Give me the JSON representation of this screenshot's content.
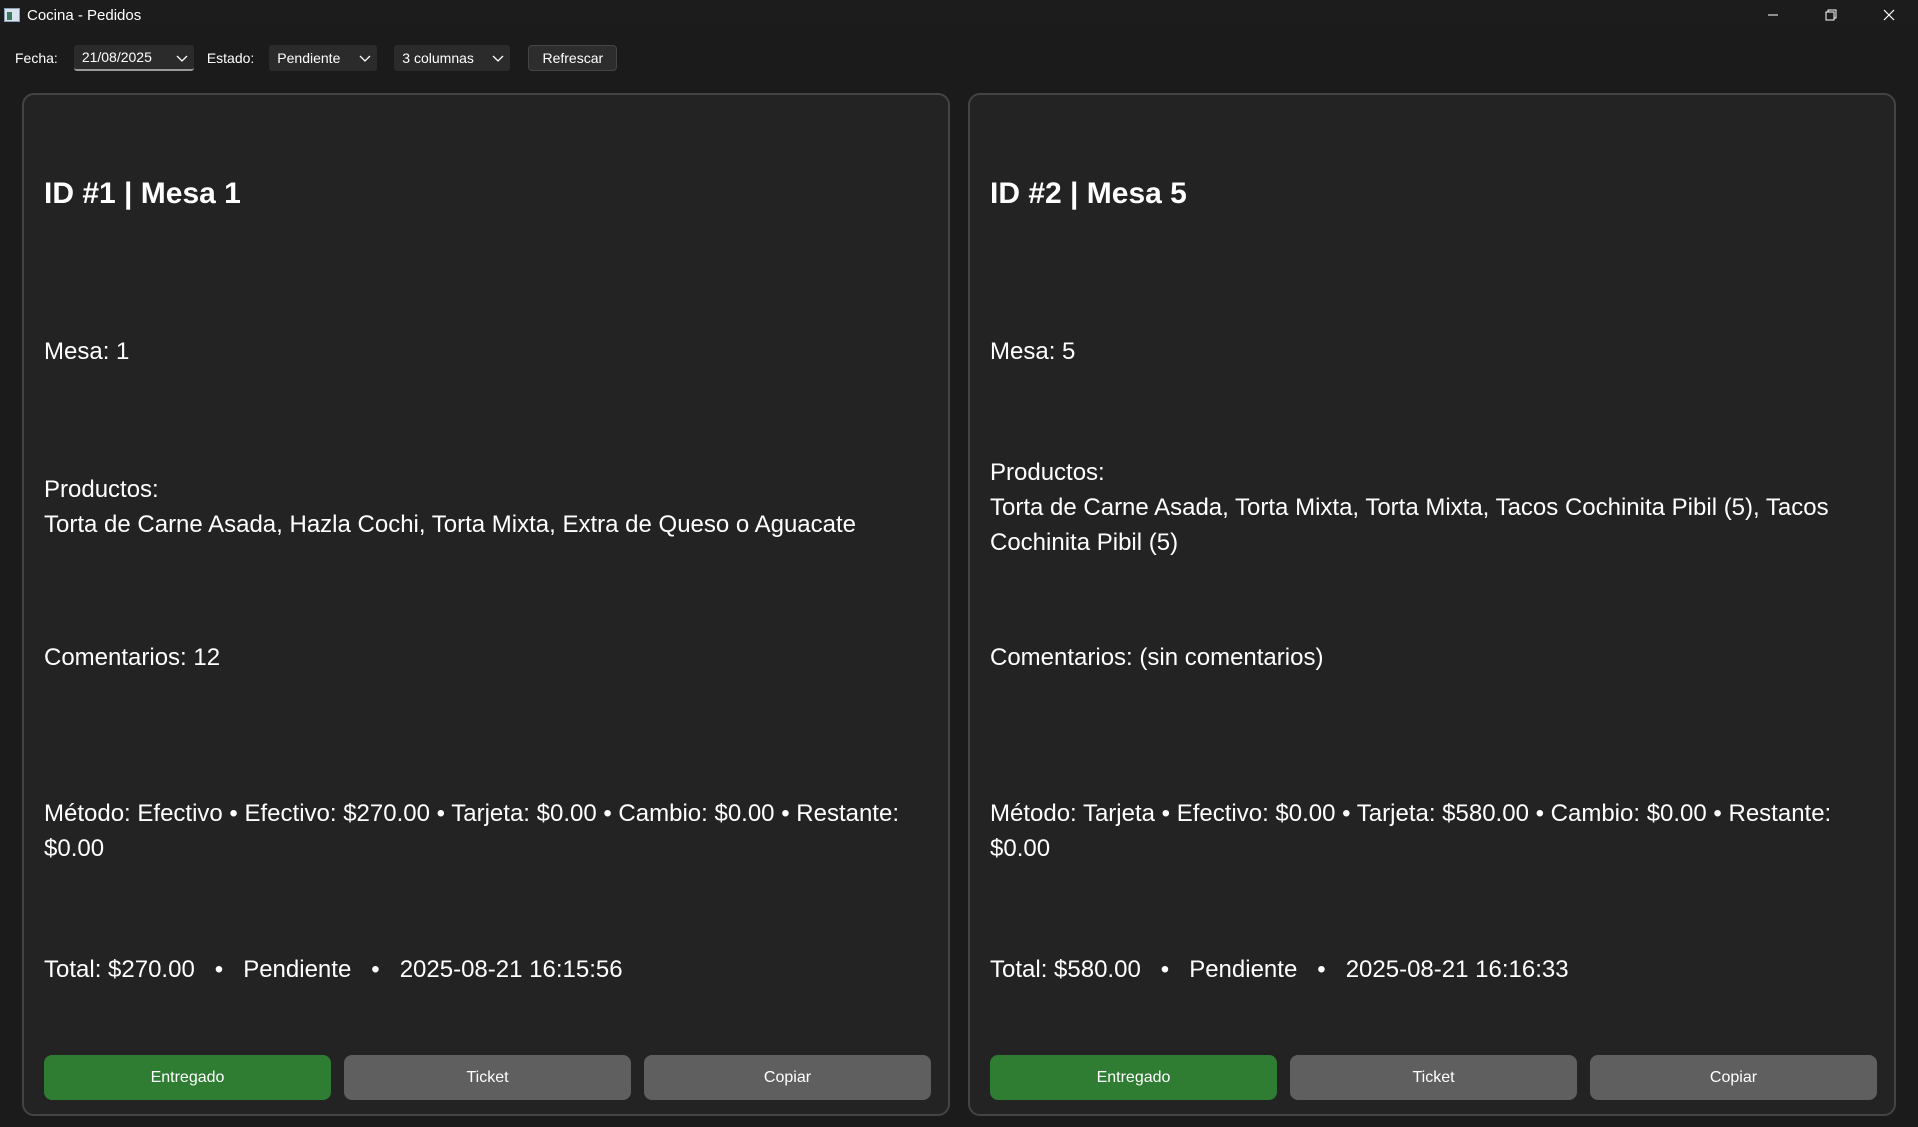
{
  "window": {
    "title": "Cocina - Pedidos"
  },
  "toolbar": {
    "fecha_label": "Fecha:",
    "fecha_value": "21/08/2025",
    "estado_label": "Estado:",
    "estado_value": "Pendiente",
    "columns_value": "3 columnas",
    "refresh_label": "Refrescar"
  },
  "orders": [
    {
      "title": "ID #1  |  Mesa 1",
      "mesa": "Mesa: 1",
      "productos_label": "Productos:",
      "productos": "Torta de Carne Asada, Hazla Cochi, Torta Mixta, Extra de Queso o Aguacate",
      "comentarios": "Comentarios: 12",
      "pago": "Método: Efectivo • Efectivo: $270.00 • Tarjeta: $0.00 • Cambio: $0.00 • Restante: $0.00",
      "resumen": "Total: $270.00   •   Pendiente   •   2025-08-21 16:15:56",
      "btn_entregado": "Entregado",
      "btn_ticket": "Ticket",
      "btn_copiar": "Copiar"
    },
    {
      "title": "ID #2  |  Mesa 5",
      "mesa": "Mesa: 5",
      "productos_label": "Productos:",
      "productos": "Torta de Carne Asada, Torta Mixta, Torta Mixta, Tacos Cochinita Pibil (5), Tacos Cochinita Pibil (5)",
      "comentarios": "Comentarios: (sin comentarios)",
      "pago": "Método: Tarjeta • Efectivo: $0.00 • Tarjeta: $580.00 • Cambio: $0.00 • Restante: $0.00",
      "resumen": "Total: $580.00   •   Pendiente   •   2025-08-21 16:16:33",
      "btn_entregado": "Entregado",
      "btn_ticket": "Ticket",
      "btn_copiar": "Copiar"
    }
  ],
  "colors": {
    "background": "#1b1b1b",
    "card": "#232323",
    "accent_green": "#2e7d32",
    "button_gray": "#5f5f5f"
  }
}
